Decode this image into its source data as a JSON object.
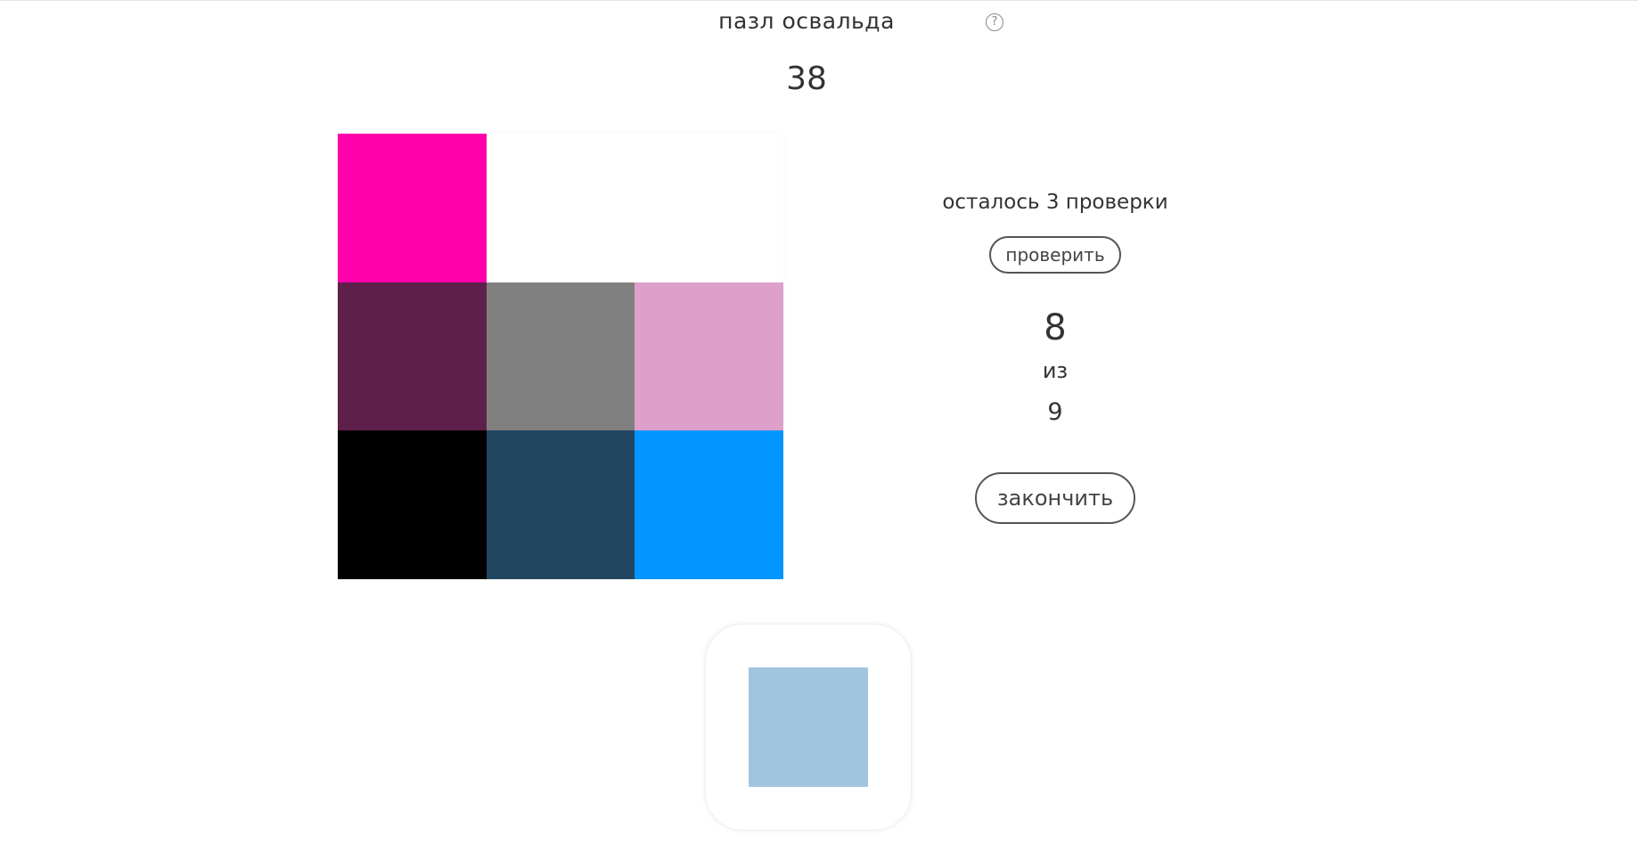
{
  "header": {
    "title": "пазл освальда",
    "help_icon_glyph": "?"
  },
  "counter": "38",
  "grid": {
    "cells": [
      {
        "color": "#ff00aa"
      },
      {
        "color": "#ffffff"
      },
      {
        "color": "#ffffff"
      },
      {
        "color": "#5e1f4a"
      },
      {
        "color": "#808080"
      },
      {
        "color": "#de9fca"
      },
      {
        "color": "#000000"
      },
      {
        "color": "#224660"
      },
      {
        "color": "#0095ff"
      }
    ]
  },
  "side_panel": {
    "checks_left": "осталось 3 проверки",
    "check_button": "проверить",
    "score": "8",
    "score_of": "из",
    "score_total": "9",
    "finish_button": "закончить"
  },
  "current_swatch": {
    "color": "#a1c5df"
  }
}
